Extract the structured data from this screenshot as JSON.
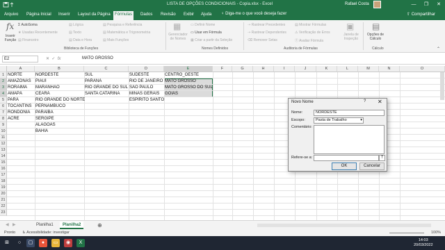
{
  "titlebar": {
    "title": "LISTA DE OPÇÕES CONDICIONAIS - Copia.xlsx  -  Excel",
    "user": "Rafael Costa",
    "min": "—",
    "max": "❐",
    "close": "✕"
  },
  "tabs": [
    "Arquivo",
    "Página Inicial",
    "Inserir",
    "Layout da Página",
    "Fórmulas",
    "Dados",
    "Revisão",
    "Exibir",
    "Ajuda"
  ],
  "tellme": "Diga-me o que você deseja fazer",
  "share": "Compartilhar",
  "ribbon": {
    "insert_function": "Inserir Função",
    "autosum": "AutoSoma",
    "recent": "Usadas Recentemente",
    "financial": "Financeiro",
    "logical": "Lógica",
    "text": "Texto",
    "datetime": "Data e Hora",
    "lookup": "Pesquisa e Referência",
    "math": "Matemática e Trigonometria",
    "more": "Mais Funções",
    "group_library": "Biblioteca de Funções",
    "name_manager": "Gerenciador de Nomes",
    "define_name": "Definir Nome",
    "use_in_formula": "Usar em Fórmula",
    "create_from_selection": "Criar a partir da Seleção",
    "group_names": "Nomes Definidos",
    "trace_precedents": "Rastrear Precedentes",
    "trace_dependents": "Rastrear Dependentes",
    "remove_arrows": "Remover Setas",
    "show_formulas": "Mostrar Fórmulas",
    "error_checking": "Verificação de Erros",
    "evaluate": "Avaliar Fórmula",
    "watch_window": "Janela de Inspeção",
    "group_audit": "Auditoria de Fórmulas",
    "calc_options": "Opções de Cálculo",
    "group_calc": "Cálculo"
  },
  "formula_bar": {
    "name_box": "E2",
    "fx": "fx",
    "content": "MATO GROSSO"
  },
  "columns": [
    "A",
    "B",
    "C",
    "D",
    "E",
    "F",
    "G",
    "H",
    "I",
    "J",
    "K",
    "L",
    "M",
    "N",
    "O"
  ],
  "rows": [
    "1",
    "2",
    "3",
    "4",
    "5",
    "6",
    "7",
    "8",
    "9",
    "10",
    "11",
    "12",
    "13",
    "14",
    "15",
    "16",
    "17",
    "18",
    "19",
    "20",
    "21",
    "22",
    "23"
  ],
  "cells": {
    "A": [
      "NORTE",
      "AMAZONAS",
      "RORAIMA",
      "AMAPÁ",
      "PARÁ",
      "TOCANTINS",
      "RONDÔNIA",
      "ACRE"
    ],
    "B": [
      "NORDESTE",
      "PIAUÍ",
      "MARANHÃO",
      "CEARÁ",
      "RIO GRANDE DO NORTE",
      "PERNAMBUCO",
      "PARAÍBA",
      "SERGIPE",
      "ALAGOAS",
      "BAHIA"
    ],
    "C": [
      "SUL",
      "PARANÁ",
      "RIO GRANDE DO SUL",
      "SANTA CATARINA"
    ],
    "D": [
      "SUDESTE",
      "RIO DE JANEIRO",
      "SÃO PAULO",
      "MINAS GERAIS",
      "ESPÍRITO SANTO"
    ],
    "E": [
      "CENTRO_OESTE",
      "MATO GROSSO",
      "MATO GROSSO DO SUL",
      "GOIÁS"
    ]
  },
  "sheets": [
    "Planilha1",
    "Planilha2"
  ],
  "status": {
    "ready": "Pronto",
    "accessibility": "Acessibilidade: investigar",
    "zoom": "100%"
  },
  "dialog": {
    "title": "Novo Nome",
    "help": "?",
    "close": "✕",
    "name_label": "Nome:",
    "name_value": "NORDESTE",
    "scope_label": "Escopo:",
    "scope_value": "Pasta de Trabalho",
    "comment_label": "Comentário:",
    "refers_label": "Refere-se a:",
    "refers_value": "",
    "ok": "OK",
    "cancel": "Cancelar"
  },
  "clock": {
    "time": "14:03",
    "date": "20/03/2022"
  },
  "colors": {
    "accent": "#217346",
    "taskbar": "#1f2633"
  }
}
